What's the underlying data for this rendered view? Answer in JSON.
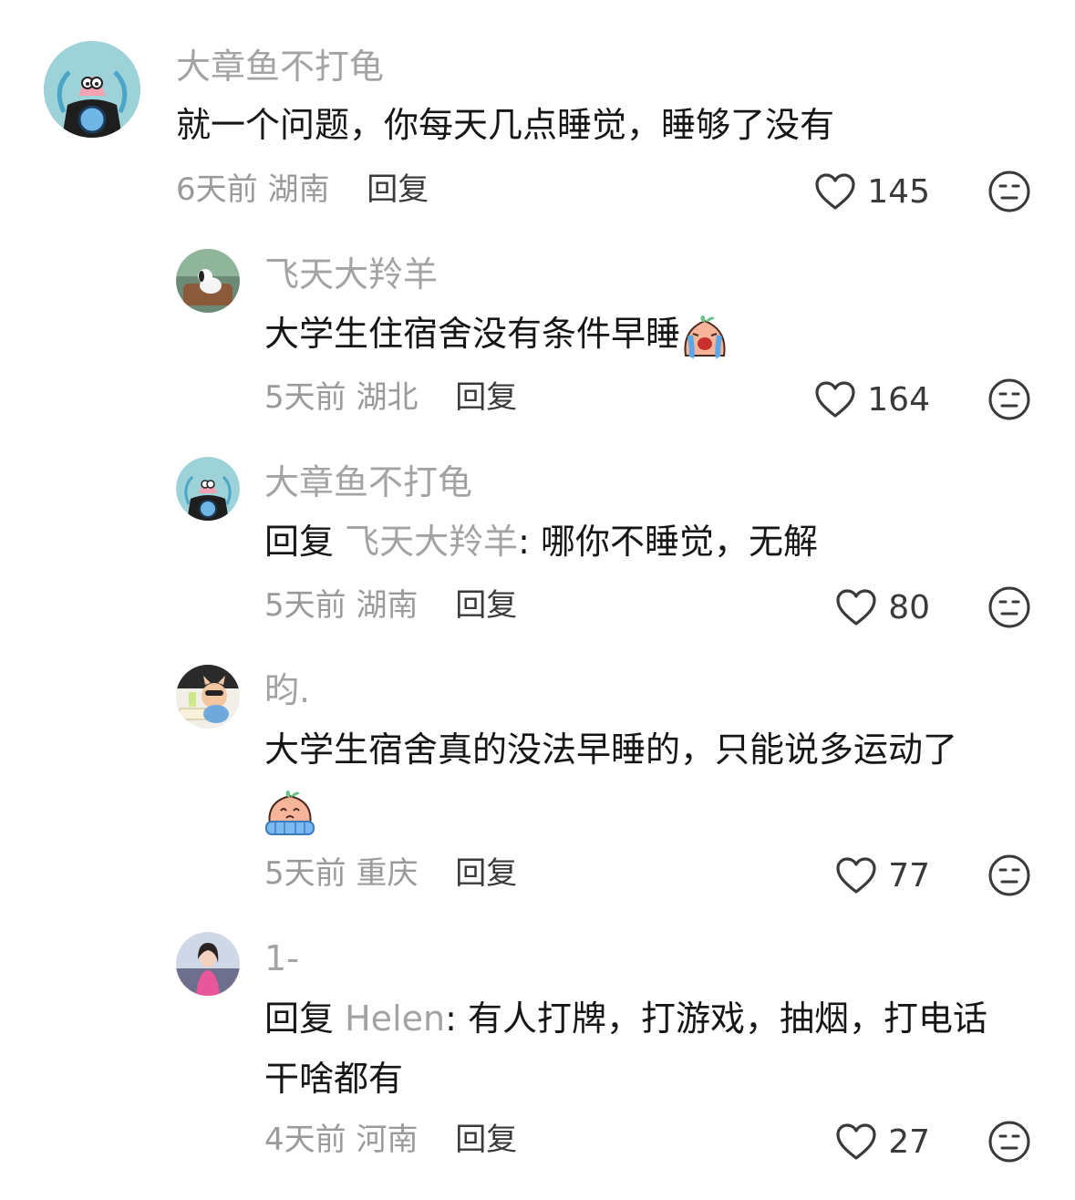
{
  "comments": [
    {
      "username": "大章鱼不打龟",
      "text": "就一个问题，你每天几点睡觉，睡够了没有",
      "time": "6天前",
      "location": "湖南",
      "reply_label": "回复",
      "likes": "145"
    },
    {
      "username": "飞天大羚羊",
      "text": "大学生住宿舍没有条件早睡",
      "emoji": "crying-face-emoji",
      "time": "5天前",
      "location": "湖北",
      "reply_label": "回复",
      "likes": "164"
    },
    {
      "username": "大章鱼不打龟",
      "reply_prefix": "回复",
      "mention": "飞天大羚羊",
      "text": ": 哪你不睡觉，无解",
      "time": "5天前",
      "location": "湖南",
      "reply_label": "回复",
      "likes": "80"
    },
    {
      "username": "昀.",
      "text": "大学生宿舍真的没法早睡的，只能说多运动了",
      "emoji": "crying-face-emoji",
      "time": "5天前",
      "location": "重庆",
      "reply_label": "回复",
      "likes": "77"
    },
    {
      "username": "1-",
      "reply_prefix": "回复",
      "mention": "Helen",
      "text": ": 有人打牌，打游戏，抽烟，打电话干啥都有",
      "time": "4天前",
      "location": "河南",
      "reply_label": "回复",
      "likes": "27"
    }
  ],
  "colors": {
    "username": "#a3a3a3",
    "text": "#161616",
    "meta": "#9a9a9a",
    "action": "#3a3a3a"
  }
}
